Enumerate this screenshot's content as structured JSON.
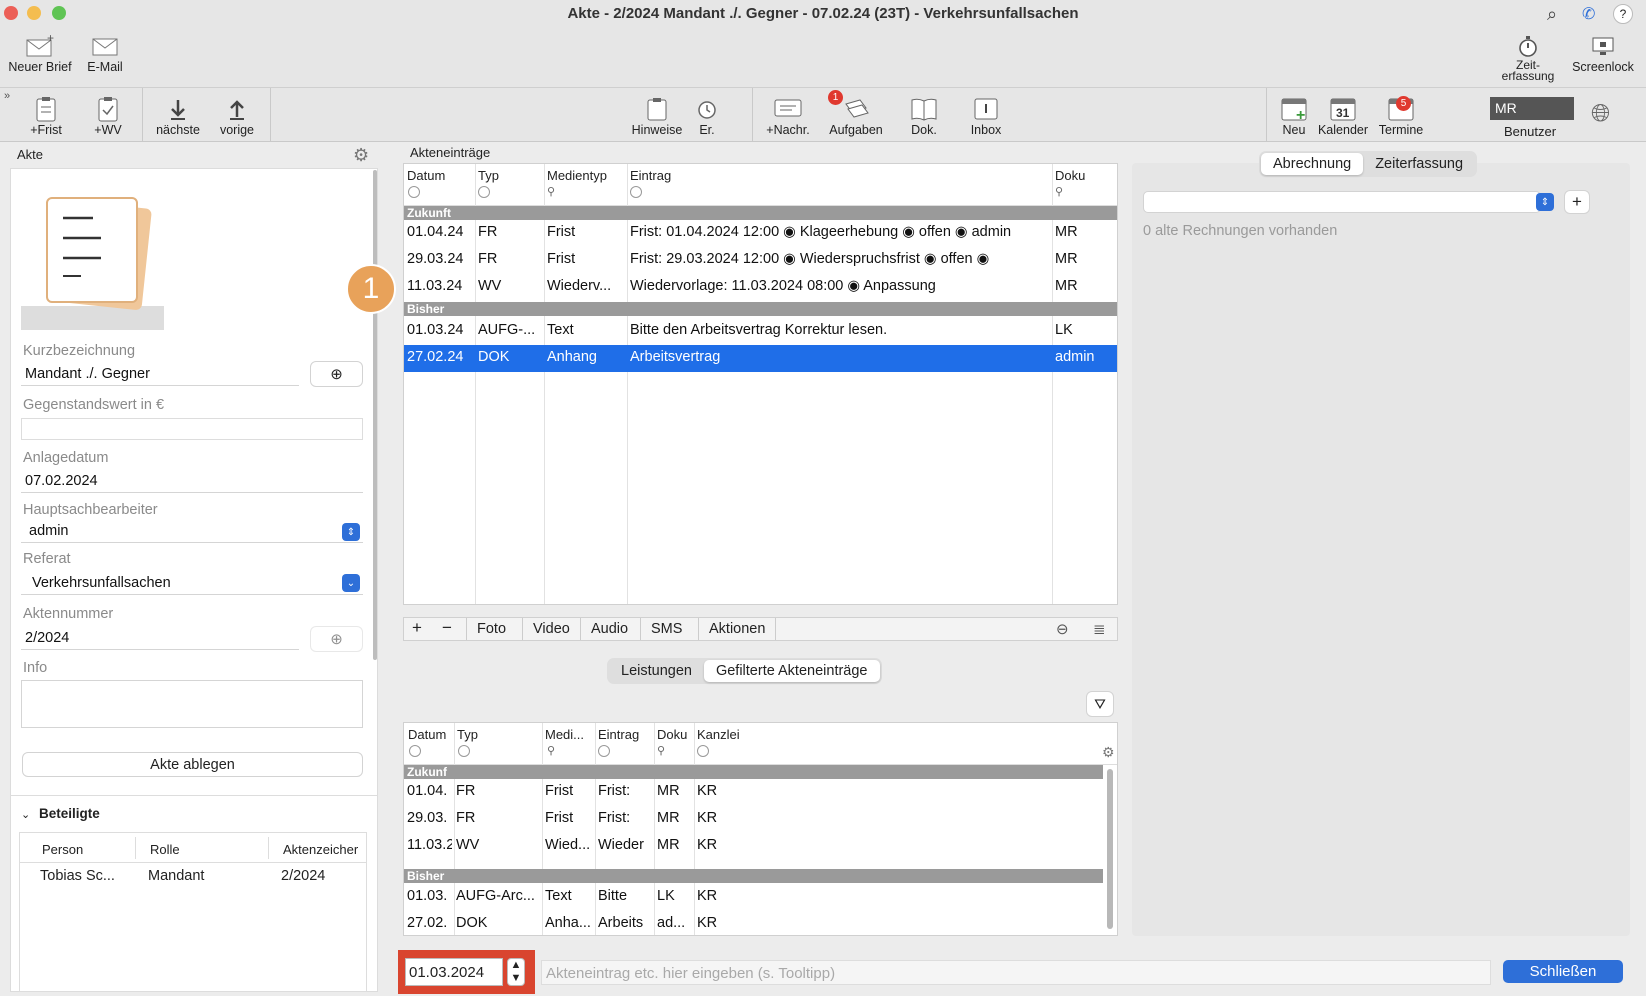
{
  "window": {
    "title": "Akte - 2/2024 Mandant ./. Gegner - 07.02.24 (23T) - Verkehrsunfallsachen"
  },
  "toolbar_top": {
    "new_letter": "Neuer Brief",
    "email": "E-Mail",
    "time_tracking": "Zeit-\nerfassung",
    "screenlock": "Screenlock"
  },
  "toolbar": {
    "frist": "+Frist",
    "wv": "+WV",
    "next": "nächste",
    "prev": "vorige",
    "hints": "Hinweise",
    "er": "Er.",
    "new_msg": "+Nachr.",
    "tasks": "Aufgaben",
    "tasks_badge": "1",
    "docs": "Dok.",
    "inbox": "Inbox",
    "new": "Neu",
    "calendar": "Kalender",
    "calendar_day": "31",
    "appointments": "Termine",
    "appointments_badge": "5",
    "user_initials": "MR",
    "user_label": "Benutzer"
  },
  "left": {
    "header": "Akte",
    "short_label": "Kurzbezeichnung",
    "short_value": "Mandant ./. Gegner",
    "value_label": "Gegenstandswert in €",
    "value_value": "",
    "created_label": "Anlagedatum",
    "created_value": "07.02.2024",
    "clerk_label": "Hauptsachbearbeiter",
    "clerk_value": "admin",
    "dept_label": "Referat",
    "dept_value": "Verkehrsunfallsachen",
    "number_label": "Aktennummer",
    "number_value": "2/2024",
    "info_label": "Info",
    "info_value": "",
    "archive_button": "Akte ablegen",
    "parties_header": "Beteiligte",
    "parties_cols": [
      "Person",
      "Rolle",
      "Aktenzeicher"
    ],
    "parties_rows": [
      [
        "Tobias Sc...",
        "Mandant",
        "2/2024"
      ]
    ]
  },
  "marker": "1",
  "entries": {
    "header": "Akteneinträge",
    "cols": [
      "Datum",
      "Typ",
      "Medientyp",
      "Eintrag",
      "Doku"
    ],
    "group_future": "Zukunft",
    "group_past": "Bisher",
    "future": [
      [
        "01.04.24",
        "FR",
        "Frist",
        "Frist: 01.04.2024 12:00 ◉ Klageerhebung ◉ offen ◉ admin",
        "MR"
      ],
      [
        "29.03.24",
        "FR",
        "Frist",
        "Frist: 29.03.2024 12:00 ◉ Wiederspruchsfrist ◉ offen ◉",
        "MR"
      ],
      [
        "11.03.24",
        "WV",
        "Wiederv...",
        "Wiedervorlage: 11.03.2024 08:00 ◉ Anpassung",
        "MR"
      ]
    ],
    "past": [
      [
        "01.03.24",
        "AUFG-...",
        "Text",
        "Bitte den Arbeitsvertrag Korrektur lesen.",
        "LK"
      ],
      [
        "27.02.24",
        "DOK",
        "Anhang",
        "Arbeitsvertrag",
        "admin"
      ]
    ],
    "actions": [
      "Foto",
      "Video",
      "Audio",
      "SMS",
      "Aktionen"
    ]
  },
  "lower": {
    "tabs": [
      "Leistungen",
      "Gefilterte Akteneinträge"
    ],
    "cols": [
      "Datum",
      "Typ",
      "Medi...",
      "Eintrag",
      "Doku",
      "Kanzlei"
    ],
    "group_future": "Zukunf",
    "group_past": "Bisher",
    "future": [
      [
        "01.04.",
        "FR",
        "Frist",
        "Frist:",
        "MR",
        "KR"
      ],
      [
        "29.03.",
        "FR",
        "Frist",
        "Frist:",
        "MR",
        "KR"
      ],
      [
        "11.03.2",
        "WV",
        "Wied...",
        "Wieder",
        "MR",
        "KR"
      ]
    ],
    "past": [
      [
        "01.03.",
        "AUFG-Arc...",
        "Text",
        "Bitte",
        "LK",
        "KR"
      ],
      [
        "27.02.",
        "DOK",
        "Anha...",
        "Arbeits",
        "ad...",
        "KR"
      ]
    ]
  },
  "right": {
    "tabs": [
      "Abrechnung",
      "Zeiterfassung"
    ],
    "old_invoices": "0 alte Rechnungen vorhanden"
  },
  "bottom": {
    "date": "01.03.2024",
    "entry_placeholder": "Akteneintrag etc. hier eingeben (s. Tooltipp)",
    "close": "Schließen"
  },
  "colors": {
    "accent": "#2e6fd8",
    "selection": "#1f6ee8",
    "badge": "#e0392f",
    "marker": "#e8a25a",
    "date_box": "#d9452f"
  }
}
